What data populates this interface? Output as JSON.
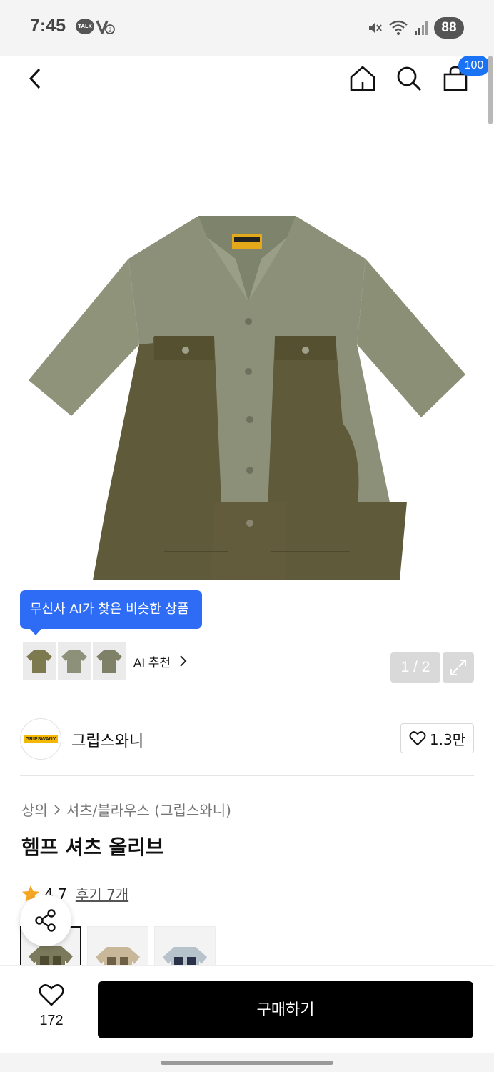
{
  "status_bar": {
    "time": "7:45",
    "talk_icon_text": "TALK",
    "battery": "88"
  },
  "nav": {
    "cart_badge": "100"
  },
  "hero": {
    "ai_tooltip": "무신사 AI가 찾은 비슷한 상품",
    "ai_reco_label": "AI 추천",
    "image_counter": "1 / 2"
  },
  "brand": {
    "logo_text": "GRIPSWANY",
    "name": "그립스와니",
    "likes": "1.3만"
  },
  "breadcrumb": {
    "category": "상의",
    "subcategory": "셔츠/블라우스 (그립스와니)"
  },
  "product": {
    "title": "헴프 셔츠 올리브",
    "rating": "4.7",
    "reviews": "후기 7개"
  },
  "colors": [
    "olive",
    "beige",
    "light-blue"
  ],
  "bottom": {
    "like_count": "172",
    "buy_label": "구매하기"
  },
  "palette": {
    "accent_blue": "#2e6cf5",
    "badge_blue": "#1a73f5",
    "star": "#f5a623",
    "buy_bg": "#000000"
  }
}
